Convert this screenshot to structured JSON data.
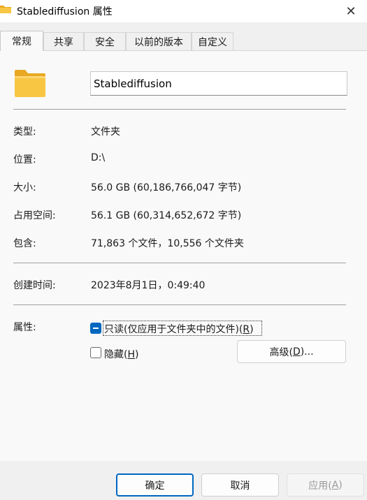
{
  "window": {
    "title": "Stablediffusion 属性",
    "close_glyph": "✕"
  },
  "tabs": [
    {
      "label": "常规"
    },
    {
      "label": "共享"
    },
    {
      "label": "安全"
    },
    {
      "label": "以前的版本"
    },
    {
      "label": "自定义"
    }
  ],
  "general": {
    "folder_name": "Stablediffusion",
    "type_label": "类型:",
    "type_value": "文件夹",
    "location_label": "位置:",
    "location_value": "D:\\",
    "size_label": "大小:",
    "size_value": "56.0 GB (60,186,766,047 字节)",
    "size_on_disk_label": "占用空间:",
    "size_on_disk_value": "56.1 GB (60,314,652,672 字节)",
    "contains_label": "包含:",
    "contains_value": "71,863 个文件，10,556 个文件夹",
    "created_label": "创建时间:",
    "created_value": "2023年8月1日，0:49:40",
    "attributes_label": "属性:",
    "readonly_text": "只读(仅应用于文件夹中的文件)(",
    "readonly_key": "R",
    "readonly_tail": ")",
    "hidden_text": "隐藏(",
    "hidden_key": "H",
    "hidden_tail": ")",
    "advanced_text": "高级(",
    "advanced_key": "D",
    "advanced_tail": ")..."
  },
  "footer": {
    "ok": "确定",
    "cancel": "取消",
    "apply_text": "应用(",
    "apply_key": "A",
    "apply_tail": ")"
  },
  "colors": {
    "accent": "#0067c0",
    "folder": "#f8c643"
  }
}
